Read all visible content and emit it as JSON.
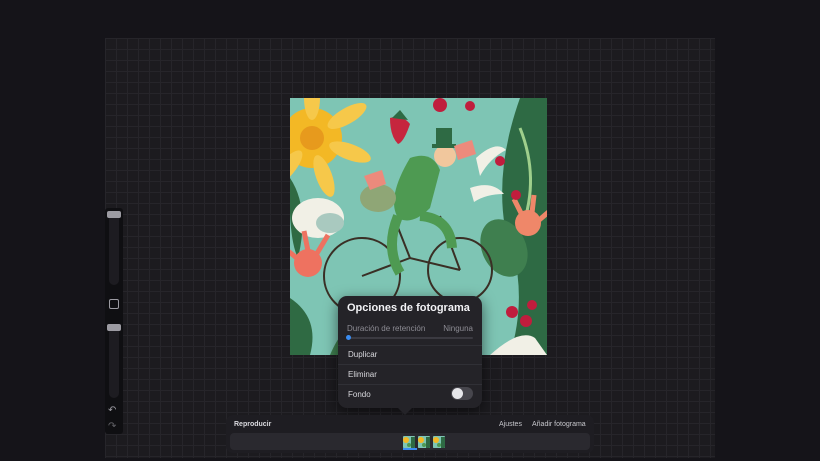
{
  "frame_options": {
    "title": "Opciones de fotograma",
    "hold_duration_label": "Duración de retención",
    "hold_duration_value": "Ninguna",
    "hold_duration_fraction": 0,
    "duplicate_label": "Duplicar",
    "delete_label": "Eliminar",
    "background_label": "Fondo",
    "background_enabled": false
  },
  "timeline": {
    "play_label": "Reproducir",
    "settings_label": "Ajustes",
    "add_frame_label": "Añadir fotograma",
    "frames": [
      {
        "selected": true
      },
      {
        "selected": false
      },
      {
        "selected": false
      }
    ]
  },
  "sidebar": {
    "icons": [
      "undo-icon",
      "redo-icon"
    ]
  },
  "colors": {
    "accent": "#3a8df2",
    "artwork_bg": "#7ec5b4"
  }
}
